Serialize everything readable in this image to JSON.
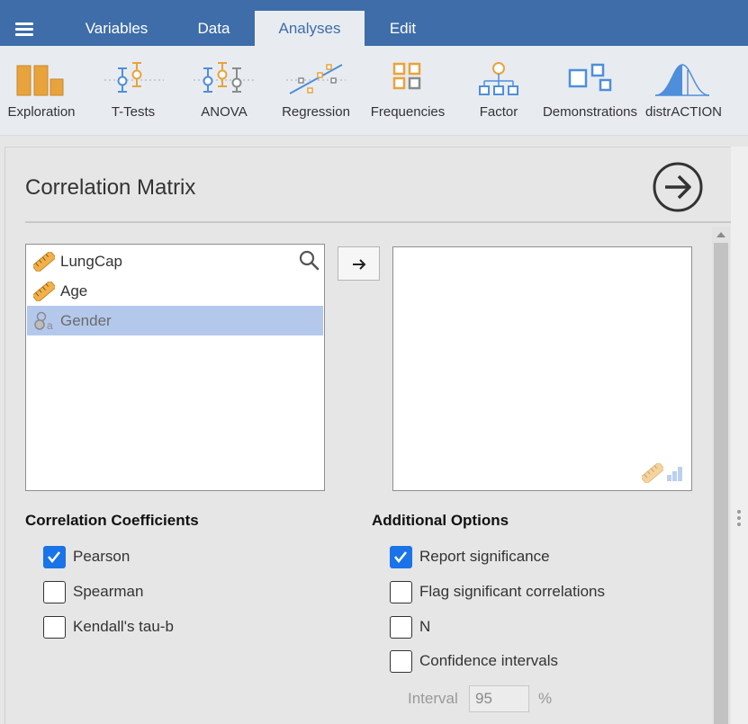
{
  "menu": {
    "tabs": [
      {
        "label": "Variables"
      },
      {
        "label": "Data"
      },
      {
        "label": "Analyses"
      },
      {
        "label": "Edit"
      }
    ],
    "active_tab": "Analyses"
  },
  "ribbon": {
    "items": [
      {
        "label": "Exploration",
        "icon": "bar-chart-icon"
      },
      {
        "label": "T-Tests",
        "icon": "ttest-icon"
      },
      {
        "label": "ANOVA",
        "icon": "anova-icon"
      },
      {
        "label": "Regression",
        "icon": "regression-icon"
      },
      {
        "label": "Frequencies",
        "icon": "frequencies-icon"
      },
      {
        "label": "Factor",
        "icon": "factor-icon"
      },
      {
        "label": "Demonstrations",
        "icon": "demonstrations-icon"
      },
      {
        "label": "distrACTION",
        "icon": "distribution-curve-icon"
      }
    ]
  },
  "panel": {
    "title": "Correlation Matrix",
    "source_variables": [
      {
        "name": "LungCap",
        "type": "continuous",
        "icon": "ruler-icon"
      },
      {
        "name": "Age",
        "type": "continuous",
        "icon": "ruler-icon"
      },
      {
        "name": "Gender",
        "type": "nominal",
        "icon": "nominal-icon",
        "selected": true
      }
    ],
    "target_variables": [],
    "target_accepts": [
      "ruler-icon",
      "ordinal-bars-icon"
    ]
  },
  "correlation_coefficients": {
    "title": "Correlation Coefficients",
    "options": [
      {
        "label": "Pearson",
        "checked": true
      },
      {
        "label": "Spearman",
        "checked": false
      },
      {
        "label": "Kendall's tau-b",
        "checked": false
      }
    ]
  },
  "additional_options": {
    "title": "Additional Options",
    "options": [
      {
        "label": "Report significance",
        "checked": true
      },
      {
        "label": "Flag significant correlations",
        "checked": false
      },
      {
        "label": "N",
        "checked": false
      },
      {
        "label": "Confidence intervals",
        "checked": false
      }
    ],
    "interval": {
      "label": "Interval",
      "value": "95",
      "unit": "%"
    }
  },
  "colors": {
    "menu_bar": "#3e6da9",
    "ribbon_bg": "#e8ecf1",
    "icon_orange": "#e8a33c",
    "icon_blue": "#4f8edb",
    "checkbox_on": "#1a73e8",
    "selection": "#b4c8ec"
  }
}
